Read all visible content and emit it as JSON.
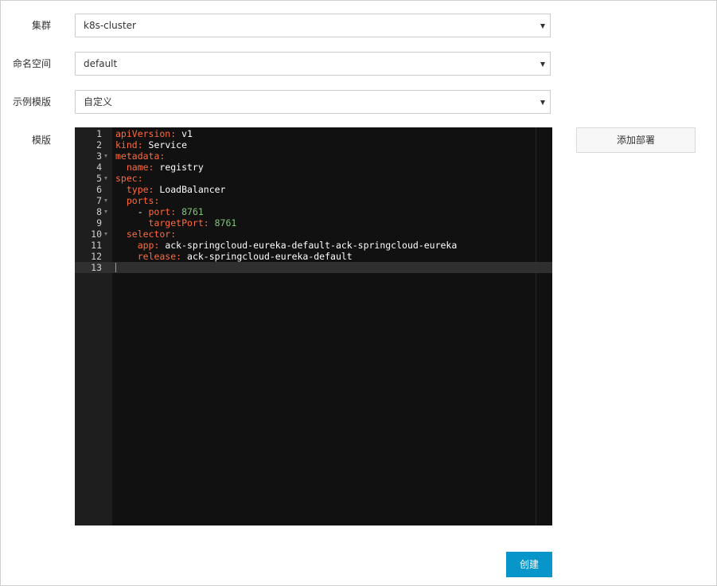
{
  "form": {
    "cluster": {
      "label": "集群",
      "value": "k8s-cluster"
    },
    "namespace": {
      "label": "命名空间",
      "value": "default"
    },
    "sample_template": {
      "label": "示例模版",
      "value": "自定义"
    },
    "template": {
      "label": "模版"
    }
  },
  "buttons": {
    "add_deployment": "添加部署",
    "create": "创建"
  },
  "colors": {
    "key": "#ff6a3d",
    "value": "#ffffff",
    "number": "#7fc57a",
    "editor_bg": "#111111",
    "primary_button": "#0896ca"
  },
  "editor": {
    "active_line": 13,
    "lines": [
      {
        "n": "1",
        "fold": false,
        "tokens": [
          {
            "t": "apiVersion:",
            "c": "key"
          },
          {
            "t": " v1",
            "c": "value"
          }
        ]
      },
      {
        "n": "2",
        "fold": false,
        "tokens": [
          {
            "t": "kind:",
            "c": "key"
          },
          {
            "t": " Service",
            "c": "value"
          }
        ]
      },
      {
        "n": "3",
        "fold": true,
        "tokens": [
          {
            "t": "metadata:",
            "c": "key"
          }
        ]
      },
      {
        "n": "4",
        "fold": false,
        "tokens": [
          {
            "t": "  name:",
            "c": "key"
          },
          {
            "t": " registry",
            "c": "value"
          }
        ]
      },
      {
        "n": "5",
        "fold": true,
        "tokens": [
          {
            "t": "spec:",
            "c": "key"
          }
        ]
      },
      {
        "n": "6",
        "fold": false,
        "tokens": [
          {
            "t": "  type:",
            "c": "key"
          },
          {
            "t": " LoadBalancer",
            "c": "value"
          }
        ]
      },
      {
        "n": "7",
        "fold": true,
        "tokens": [
          {
            "t": "  ports:",
            "c": "key"
          }
        ]
      },
      {
        "n": "8",
        "fold": true,
        "tokens": [
          {
            "t": "    - ",
            "c": "value"
          },
          {
            "t": "port:",
            "c": "key"
          },
          {
            "t": " 8761",
            "c": "number"
          }
        ]
      },
      {
        "n": "9",
        "fold": false,
        "tokens": [
          {
            "t": "      targetPort:",
            "c": "key"
          },
          {
            "t": " 8761",
            "c": "number"
          }
        ]
      },
      {
        "n": "10",
        "fold": true,
        "tokens": [
          {
            "t": "  selector:",
            "c": "key"
          }
        ]
      },
      {
        "n": "11",
        "fold": false,
        "tokens": [
          {
            "t": "    app:",
            "c": "key"
          },
          {
            "t": " ack-springcloud-eureka-default-ack-springcloud-eureka",
            "c": "value"
          }
        ]
      },
      {
        "n": "12",
        "fold": false,
        "tokens": [
          {
            "t": "    release:",
            "c": "key"
          },
          {
            "t": " ack-springcloud-eureka-default",
            "c": "value"
          }
        ]
      },
      {
        "n": "13",
        "fold": false,
        "tokens": []
      }
    ]
  }
}
